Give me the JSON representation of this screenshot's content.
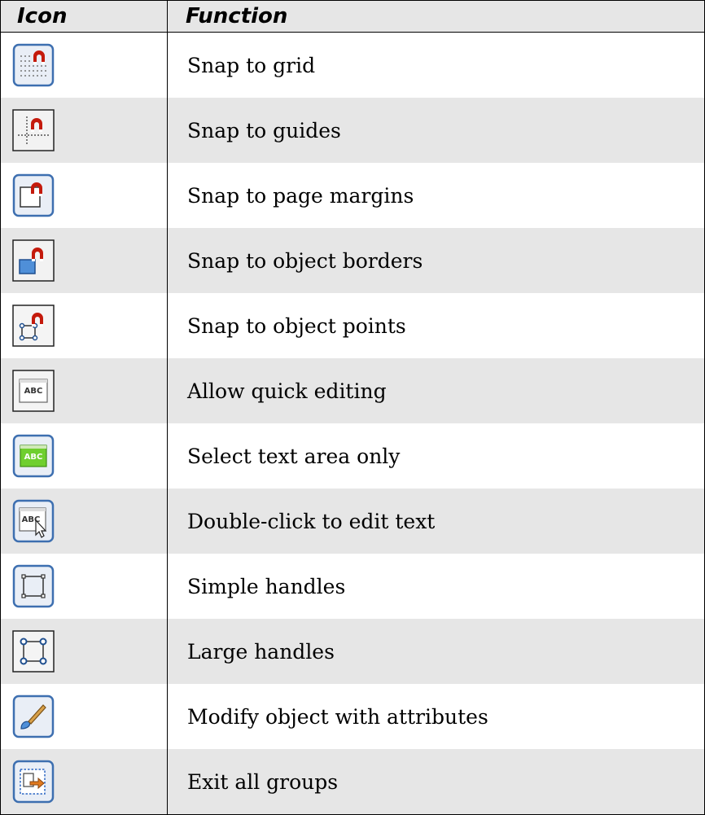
{
  "table": {
    "headers": {
      "icon": "Icon",
      "function": "Function"
    },
    "rows": [
      {
        "icon": "snap-to-grid-icon",
        "function": "Snap to grid"
      },
      {
        "icon": "snap-to-guides-icon",
        "function": "Snap to guides"
      },
      {
        "icon": "snap-to-page-margins-icon",
        "function": "Snap to page margins"
      },
      {
        "icon": "snap-to-object-borders-icon",
        "function": "Snap to object borders"
      },
      {
        "icon": "snap-to-object-points-icon",
        "function": "Snap to object points"
      },
      {
        "icon": "allow-quick-editing-icon",
        "function": "Allow quick editing"
      },
      {
        "icon": "select-text-area-only-icon",
        "function": "Select text area only"
      },
      {
        "icon": "double-click-to-edit-text-icon",
        "function": "Double-click to edit text"
      },
      {
        "icon": "simple-handles-icon",
        "function": "Simple handles"
      },
      {
        "icon": "large-handles-icon",
        "function": "Large handles"
      },
      {
        "icon": "modify-object-with-attributes-icon",
        "function": "Modify object with attributes"
      },
      {
        "icon": "exit-all-groups-icon",
        "function": "Exit all groups"
      }
    ]
  },
  "colors": {
    "header_bg": "#e6e6e6",
    "alt_row_bg": "#e6e6e6",
    "border": "#000000",
    "magnet_red": "#c41a0c",
    "icon_blue": "#3d6fb0"
  }
}
